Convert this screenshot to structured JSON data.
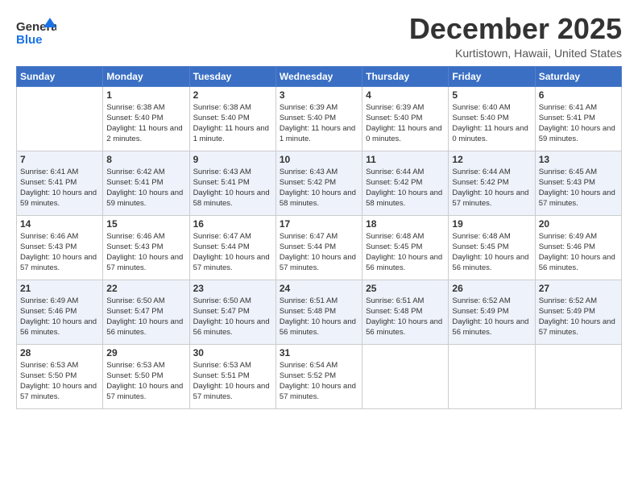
{
  "header": {
    "logo_line1": "General",
    "logo_line2": "Blue",
    "month": "December 2025",
    "location": "Kurtistown, Hawaii, United States"
  },
  "days_of_week": [
    "Sunday",
    "Monday",
    "Tuesday",
    "Wednesday",
    "Thursday",
    "Friday",
    "Saturday"
  ],
  "weeks": [
    [
      {
        "day": "",
        "sunrise": "",
        "sunset": "",
        "daylight": ""
      },
      {
        "day": "1",
        "sunrise": "Sunrise: 6:38 AM",
        "sunset": "Sunset: 5:40 PM",
        "daylight": "Daylight: 11 hours and 2 minutes."
      },
      {
        "day": "2",
        "sunrise": "Sunrise: 6:38 AM",
        "sunset": "Sunset: 5:40 PM",
        "daylight": "Daylight: 11 hours and 1 minute."
      },
      {
        "day": "3",
        "sunrise": "Sunrise: 6:39 AM",
        "sunset": "Sunset: 5:40 PM",
        "daylight": "Daylight: 11 hours and 1 minute."
      },
      {
        "day": "4",
        "sunrise": "Sunrise: 6:39 AM",
        "sunset": "Sunset: 5:40 PM",
        "daylight": "Daylight: 11 hours and 0 minutes."
      },
      {
        "day": "5",
        "sunrise": "Sunrise: 6:40 AM",
        "sunset": "Sunset: 5:40 PM",
        "daylight": "Daylight: 11 hours and 0 minutes."
      },
      {
        "day": "6",
        "sunrise": "Sunrise: 6:41 AM",
        "sunset": "Sunset: 5:41 PM",
        "daylight": "Daylight: 10 hours and 59 minutes."
      }
    ],
    [
      {
        "day": "7",
        "sunrise": "Sunrise: 6:41 AM",
        "sunset": "Sunset: 5:41 PM",
        "daylight": "Daylight: 10 hours and 59 minutes."
      },
      {
        "day": "8",
        "sunrise": "Sunrise: 6:42 AM",
        "sunset": "Sunset: 5:41 PM",
        "daylight": "Daylight: 10 hours and 59 minutes."
      },
      {
        "day": "9",
        "sunrise": "Sunrise: 6:43 AM",
        "sunset": "Sunset: 5:41 PM",
        "daylight": "Daylight: 10 hours and 58 minutes."
      },
      {
        "day": "10",
        "sunrise": "Sunrise: 6:43 AM",
        "sunset": "Sunset: 5:42 PM",
        "daylight": "Daylight: 10 hours and 58 minutes."
      },
      {
        "day": "11",
        "sunrise": "Sunrise: 6:44 AM",
        "sunset": "Sunset: 5:42 PM",
        "daylight": "Daylight: 10 hours and 58 minutes."
      },
      {
        "day": "12",
        "sunrise": "Sunrise: 6:44 AM",
        "sunset": "Sunset: 5:42 PM",
        "daylight": "Daylight: 10 hours and 57 minutes."
      },
      {
        "day": "13",
        "sunrise": "Sunrise: 6:45 AM",
        "sunset": "Sunset: 5:43 PM",
        "daylight": "Daylight: 10 hours and 57 minutes."
      }
    ],
    [
      {
        "day": "14",
        "sunrise": "Sunrise: 6:46 AM",
        "sunset": "Sunset: 5:43 PM",
        "daylight": "Daylight: 10 hours and 57 minutes."
      },
      {
        "day": "15",
        "sunrise": "Sunrise: 6:46 AM",
        "sunset": "Sunset: 5:43 PM",
        "daylight": "Daylight: 10 hours and 57 minutes."
      },
      {
        "day": "16",
        "sunrise": "Sunrise: 6:47 AM",
        "sunset": "Sunset: 5:44 PM",
        "daylight": "Daylight: 10 hours and 57 minutes."
      },
      {
        "day": "17",
        "sunrise": "Sunrise: 6:47 AM",
        "sunset": "Sunset: 5:44 PM",
        "daylight": "Daylight: 10 hours and 57 minutes."
      },
      {
        "day": "18",
        "sunrise": "Sunrise: 6:48 AM",
        "sunset": "Sunset: 5:45 PM",
        "daylight": "Daylight: 10 hours and 56 minutes."
      },
      {
        "day": "19",
        "sunrise": "Sunrise: 6:48 AM",
        "sunset": "Sunset: 5:45 PM",
        "daylight": "Daylight: 10 hours and 56 minutes."
      },
      {
        "day": "20",
        "sunrise": "Sunrise: 6:49 AM",
        "sunset": "Sunset: 5:46 PM",
        "daylight": "Daylight: 10 hours and 56 minutes."
      }
    ],
    [
      {
        "day": "21",
        "sunrise": "Sunrise: 6:49 AM",
        "sunset": "Sunset: 5:46 PM",
        "daylight": "Daylight: 10 hours and 56 minutes."
      },
      {
        "day": "22",
        "sunrise": "Sunrise: 6:50 AM",
        "sunset": "Sunset: 5:47 PM",
        "daylight": "Daylight: 10 hours and 56 minutes."
      },
      {
        "day": "23",
        "sunrise": "Sunrise: 6:50 AM",
        "sunset": "Sunset: 5:47 PM",
        "daylight": "Daylight: 10 hours and 56 minutes."
      },
      {
        "day": "24",
        "sunrise": "Sunrise: 6:51 AM",
        "sunset": "Sunset: 5:48 PM",
        "daylight": "Daylight: 10 hours and 56 minutes."
      },
      {
        "day": "25",
        "sunrise": "Sunrise: 6:51 AM",
        "sunset": "Sunset: 5:48 PM",
        "daylight": "Daylight: 10 hours and 56 minutes."
      },
      {
        "day": "26",
        "sunrise": "Sunrise: 6:52 AM",
        "sunset": "Sunset: 5:49 PM",
        "daylight": "Daylight: 10 hours and 56 minutes."
      },
      {
        "day": "27",
        "sunrise": "Sunrise: 6:52 AM",
        "sunset": "Sunset: 5:49 PM",
        "daylight": "Daylight: 10 hours and 57 minutes."
      }
    ],
    [
      {
        "day": "28",
        "sunrise": "Sunrise: 6:53 AM",
        "sunset": "Sunset: 5:50 PM",
        "daylight": "Daylight: 10 hours and 57 minutes."
      },
      {
        "day": "29",
        "sunrise": "Sunrise: 6:53 AM",
        "sunset": "Sunset: 5:50 PM",
        "daylight": "Daylight: 10 hours and 57 minutes."
      },
      {
        "day": "30",
        "sunrise": "Sunrise: 6:53 AM",
        "sunset": "Sunset: 5:51 PM",
        "daylight": "Daylight: 10 hours and 57 minutes."
      },
      {
        "day": "31",
        "sunrise": "Sunrise: 6:54 AM",
        "sunset": "Sunset: 5:52 PM",
        "daylight": "Daylight: 10 hours and 57 minutes."
      },
      {
        "day": "",
        "sunrise": "",
        "sunset": "",
        "daylight": ""
      },
      {
        "day": "",
        "sunrise": "",
        "sunset": "",
        "daylight": ""
      },
      {
        "day": "",
        "sunrise": "",
        "sunset": "",
        "daylight": ""
      }
    ]
  ]
}
